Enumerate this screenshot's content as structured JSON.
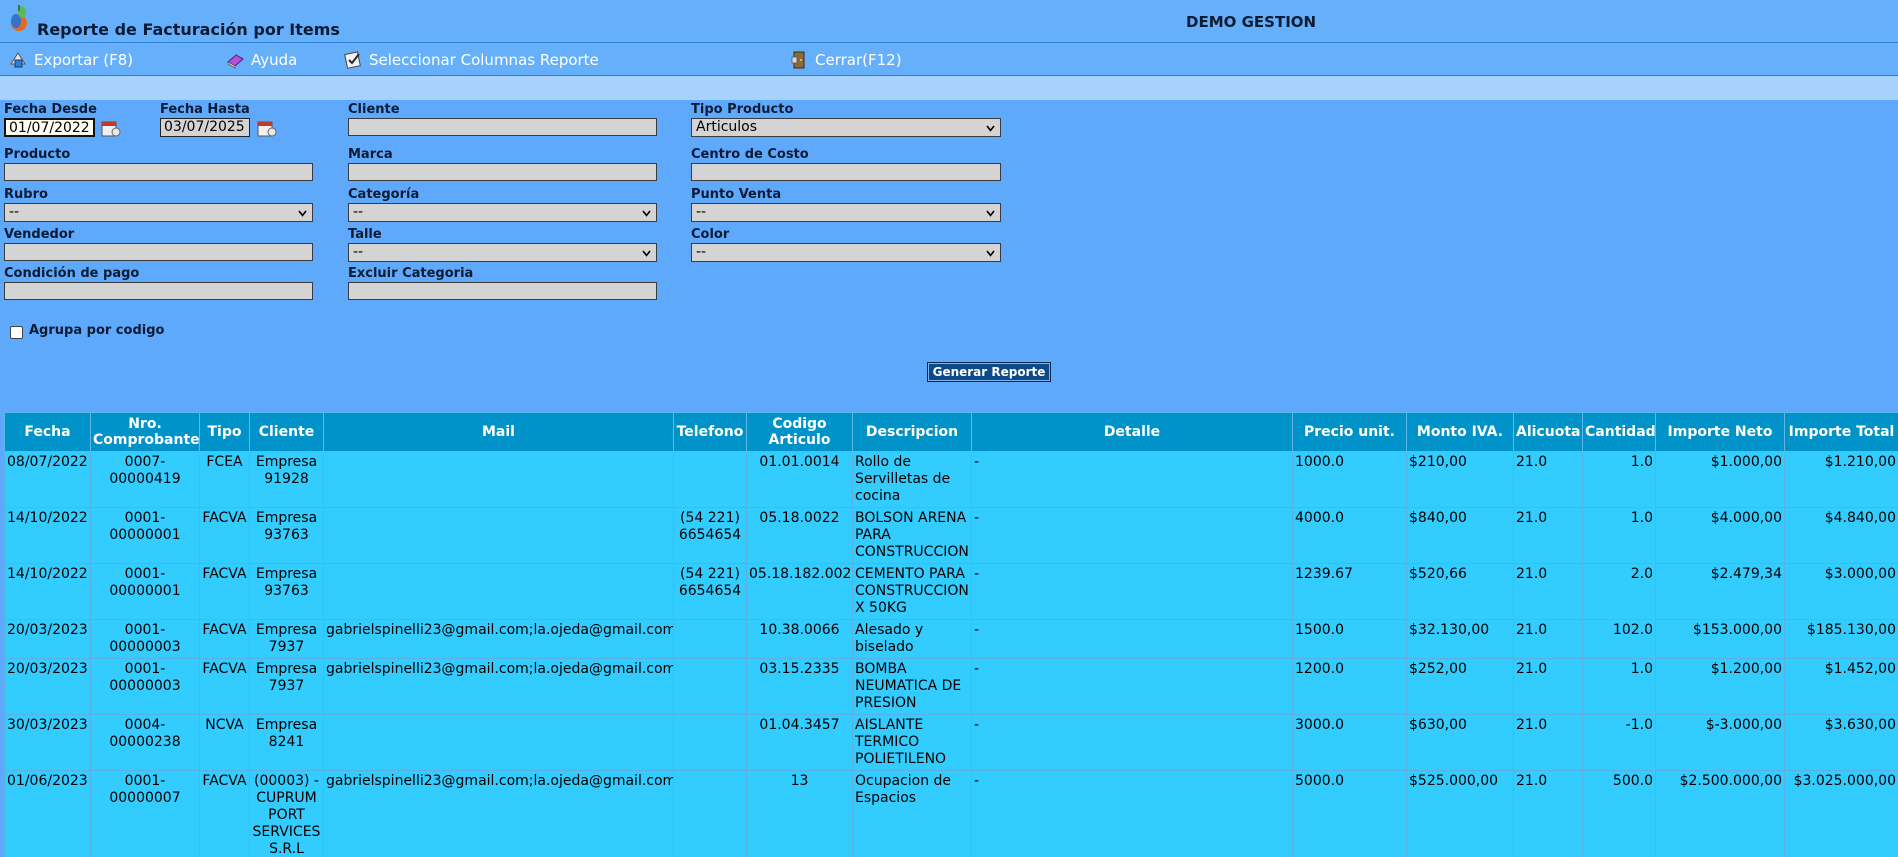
{
  "app": {
    "title": "Reporte de Facturación por Items",
    "company": "DEMO GESTION"
  },
  "toolbar": {
    "export_label": "Exportar (F8)",
    "help_label": "Ayuda",
    "columns_label": "Seleccionar Columnas Reporte",
    "close_label": "Cerrar(F12)"
  },
  "filters": {
    "fecha_desde": {
      "label": "Fecha Desde",
      "value": "01/07/2022"
    },
    "fecha_hasta": {
      "label": "Fecha Hasta",
      "value": "03/07/2025"
    },
    "cliente": {
      "label": "Cliente",
      "value": ""
    },
    "tipo_producto": {
      "label": "Tipo Producto",
      "value": "Articulos"
    },
    "producto": {
      "label": "Producto",
      "value": ""
    },
    "marca": {
      "label": "Marca",
      "value": ""
    },
    "centro_costo": {
      "label": "Centro de Costo",
      "value": ""
    },
    "rubro": {
      "label": "Rubro",
      "value": "--"
    },
    "categoria": {
      "label": "Categoría",
      "value": "--"
    },
    "punto_venta": {
      "label": "Punto Venta",
      "value": "--"
    },
    "vendedor": {
      "label": "Vendedor",
      "value": ""
    },
    "talle": {
      "label": "Talle",
      "value": "--"
    },
    "color": {
      "label": "Color",
      "value": "--"
    },
    "condicion_pago": {
      "label": "Condición de pago",
      "value": ""
    },
    "excluir_categoria": {
      "label": "Excluir Categoria",
      "value": ""
    },
    "agrupa": {
      "label": "Agrupa por codigo",
      "checked": false
    },
    "generate_label": "Generar Reporte"
  },
  "table": {
    "headers": [
      "Fecha",
      "Nro. Comprobante",
      "Tipo",
      "Cliente",
      "Mail",
      "Telefono",
      "Codigo Articulo",
      "Descripcion",
      "Detalle",
      "Precio unit.",
      "Monto IVA.",
      "Alicuota",
      "Cantidad",
      "Importe Neto",
      "Importe Total"
    ],
    "rows": [
      [
        "08/07/2022",
        "0007-00000419",
        "FCEA",
        "Empresa 91928",
        "",
        "",
        "01.01.0014",
        "Rollo de Servilletas de cocina",
        "-",
        "1000.0",
        "$210,00",
        "21.0",
        "1.0",
        "$1.000,00",
        "$1.210,00"
      ],
      [
        "14/10/2022",
        "0001-00000001",
        "FACVA",
        "Empresa 93763",
        "",
        "(54 221) 6654654",
        "05.18.0022",
        "BOLSON ARENA PARA CONSTRUCCION",
        "-",
        "4000.0",
        "$840,00",
        "21.0",
        "1.0",
        "$4.000,00",
        "$4.840,00"
      ],
      [
        "14/10/2022",
        "0001-00000001",
        "FACVA",
        "Empresa 93763",
        "",
        "(54 221) 6654654",
        "05.18.182.002",
        "CEMENTO PARA CONSTRUCCION X 50KG",
        "-",
        "1239.67",
        "$520,66",
        "21.0",
        "2.0",
        "$2.479,34",
        "$3.000,00"
      ],
      [
        "20/03/2023",
        "0001-00000003",
        "FACVA",
        "Empresa 7937",
        "gabrielspinelli23@gmail.com;la.ojeda@gmail.com",
        "",
        "10.38.0066",
        "Alesado y biselado",
        "-",
        "1500.0",
        "$32.130,00",
        "21.0",
        "102.0",
        "$153.000,00",
        "$185.130,00"
      ],
      [
        "20/03/2023",
        "0001-00000003",
        "FACVA",
        "Empresa 7937",
        "gabrielspinelli23@gmail.com;la.ojeda@gmail.com",
        "",
        "03.15.2335",
        "BOMBA NEUMATICA DE PRESION",
        "-",
        "1200.0",
        "$252,00",
        "21.0",
        "1.0",
        "$1.200,00",
        "$1.452,00"
      ],
      [
        "30/03/2023",
        "0004-00000238",
        "NCVA",
        "Empresa 8241",
        "",
        "",
        "01.04.3457",
        "AISLANTE TERMICO POLIETILENO",
        "-",
        "3000.0",
        "$630,00",
        "21.0",
        "-1.0",
        "$-3.000,00",
        "$3.630,00"
      ],
      [
        "01/06/2023",
        "0001-00000007",
        "FACVA",
        "(00003) - CUPRUM PORT SERVICES S.R.L",
        "gabrielspinelli23@gmail.com;la.ojeda@gmail.com",
        "",
        "13",
        "Ocupacion de Espacios",
        "-",
        "5000.0",
        "$525.000,00",
        "21.0",
        "500.0",
        "$2.500.000,00",
        "$3.025.000,00"
      ]
    ]
  },
  "icons": {
    "logo": "app-logo-icon",
    "export": "export-icon",
    "help": "help-book-icon",
    "columns": "checklist-icon",
    "close": "exit-door-icon",
    "calendar": "calendar-icon"
  },
  "colors": {
    "background": "#5fa9fc",
    "header_bg": "#0093c9",
    "row_bg": "#33ccff",
    "button": "#0c4a8a"
  }
}
